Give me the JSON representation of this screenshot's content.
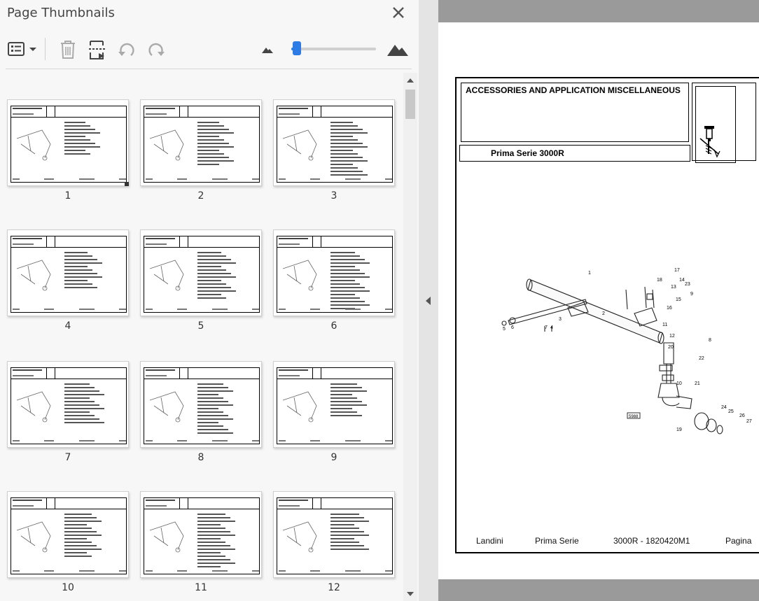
{
  "panel": {
    "title": "Page Thumbnails",
    "close_icon": "close-icon",
    "toolbar": {
      "options_icon": "thumbnail-options-icon",
      "dropdown_icon": "chevron-down-icon",
      "delete_icon": "trash-icon",
      "insert_icon": "insert-page-icon",
      "rotate_ccw_icon": "rotate-counterclockwise-icon",
      "rotate_cw_icon": "rotate-clockwise-icon",
      "zoom_out_icon": "small-mountain-icon",
      "zoom_in_icon": "large-mountain-icon",
      "zoom_slider_fraction": 0.07
    },
    "thumbnails": [
      {
        "label": "1"
      },
      {
        "label": "2"
      },
      {
        "label": "3"
      },
      {
        "label": "4"
      },
      {
        "label": "5"
      },
      {
        "label": "6"
      },
      {
        "label": "7"
      },
      {
        "label": "8"
      },
      {
        "label": "9"
      },
      {
        "label": "10"
      },
      {
        "label": "11"
      },
      {
        "label": "12"
      }
    ]
  },
  "document": {
    "title": "ACCESSORIES AND APPLICATION MISCELLANEOUS",
    "series": "Prima Serie  3000R",
    "drawing_callouts": [
      "1",
      "2",
      "3",
      "4",
      "5",
      "6",
      "7",
      "8",
      "9",
      "10",
      "11",
      "12",
      "13",
      "14",
      "15",
      "16",
      "17",
      "18",
      "19",
      "20",
      "21",
      "22",
      "23",
      "24",
      "25",
      "26",
      "27"
    ],
    "drawing_tag": "5988",
    "footer": {
      "brand": "Landini",
      "series": "Prima Serie",
      "code": "3000R - 1820420M1",
      "page_label": "Pagina"
    }
  },
  "colors": {
    "accent": "#2d7be5",
    "panel_bg": "#f7f7f7",
    "doc_bar": "#9a9a9a"
  }
}
